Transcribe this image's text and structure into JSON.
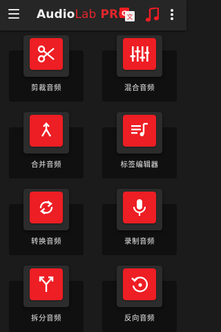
{
  "appbar": {
    "title_part1": "Audio",
    "title_part2": "Lab",
    "title_part3": " PRO",
    "menu_icon": "hamburger-menu-icon",
    "translate_icon": "translate-icon",
    "music_icon": "music-note-icon",
    "more_icon": "more-vert-icon"
  },
  "tools": [
    {
      "label": "剪裁音频",
      "icon": "scissors-icon"
    },
    {
      "label": "混合音频",
      "icon": "sliders-icon"
    },
    {
      "label": "合并音频",
      "icon": "merge-icon"
    },
    {
      "label": "标签编辑器",
      "icon": "playlist-edit-icon"
    },
    {
      "label": "转换音频",
      "icon": "sync-icon"
    },
    {
      "label": "录制音频",
      "icon": "microphone-icon"
    },
    {
      "label": "拆分音频",
      "icon": "split-icon"
    },
    {
      "label": "反向音频",
      "icon": "reverse-icon"
    }
  ],
  "colors": {
    "accent": "#ed1e24",
    "background": "#1b1b1b",
    "appbar": "#262626"
  }
}
